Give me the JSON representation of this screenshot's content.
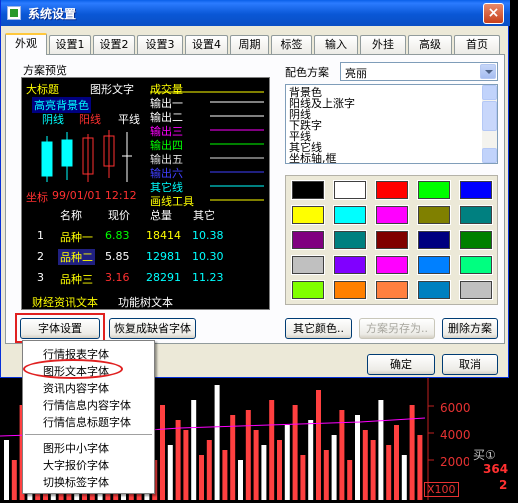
{
  "window": {
    "title": "系统设置",
    "close_glyph": "×"
  },
  "tabs": [
    "外观",
    "设置1",
    "设置2",
    "设置3",
    "设置4",
    "周期",
    "标签",
    "输入",
    "外挂",
    "高级",
    "首页"
  ],
  "preview": {
    "group_label": "方案预览",
    "big_title": "大标题",
    "graph_text": "图形文字",
    "bright_bg": "高亮背景色",
    "yang": "阴线",
    "yin": "阳线",
    "flat": "平线",
    "volume": "成交量",
    "outputs": [
      "输出一",
      "输出二",
      "输出三",
      "输出四",
      "输出五",
      "输出六"
    ],
    "other_line": "其它线",
    "draw_tool": "画线工具",
    "coord_text": "坐标",
    "coord_value": "99/01/01 12:12",
    "table_headers": [
      "名称",
      "现价",
      "总量",
      "其它"
    ],
    "rows": [
      {
        "num": "1",
        "name": "品种一",
        "price": "6.83",
        "vol": "18414",
        "other": "10.38"
      },
      {
        "num": "2",
        "name": "品种二",
        "price": "5.85",
        "vol": "12981",
        "other": "10.30"
      },
      {
        "num": "3",
        "name": "品种三",
        "price": "3.16",
        "vol": "28291",
        "other": "11.23"
      }
    ],
    "finance_text": "财经资讯文本",
    "tree_text": "功能树文本"
  },
  "scheme": {
    "label": "配色方案",
    "value": "亮丽"
  },
  "elements": [
    "背景色",
    "阳线及上涨字",
    "阴线",
    "下跌字",
    "平线",
    "其它线",
    "坐标轴,框"
  ],
  "palette": [
    "#000000",
    "#ffffff",
    "#ff0000",
    "#00ff00",
    "#0000ff",
    "#ffff00",
    "#00ffff",
    "#ff00ff",
    "#808000",
    "#008080",
    "#800080",
    "#008080",
    "#800000",
    "#000080",
    "#008000",
    "#c0c0c0",
    "#8000ff",
    "#ff00ff",
    "#0080ff",
    "#00ff80",
    "#80ff00",
    "#ff8000",
    "#ff8040",
    "#0080c0",
    "#c0c0c0"
  ],
  "buttons": {
    "font_settings": "字体设置",
    "restore_font": "恢复成缺省字体",
    "other_color": "其它颜色..",
    "save_scheme": "方案另存为..",
    "delete_scheme": "删除方案",
    "ok": "确定",
    "cancel": "取消"
  },
  "menu": {
    "items_a": [
      "行情报表字体",
      "图形文本字体",
      "资讯内容字体",
      "行情信息内容字体",
      "行情信息标题字体"
    ],
    "items_b": [
      "图形中小字体",
      "大字报价字体",
      "切换标签字体"
    ]
  },
  "chart": {
    "y_ticks": [
      "6000",
      "4000",
      "2000"
    ],
    "buy_label": "买①",
    "buy_values": [
      "364",
      "2"
    ],
    "multiplier": "X100"
  }
}
